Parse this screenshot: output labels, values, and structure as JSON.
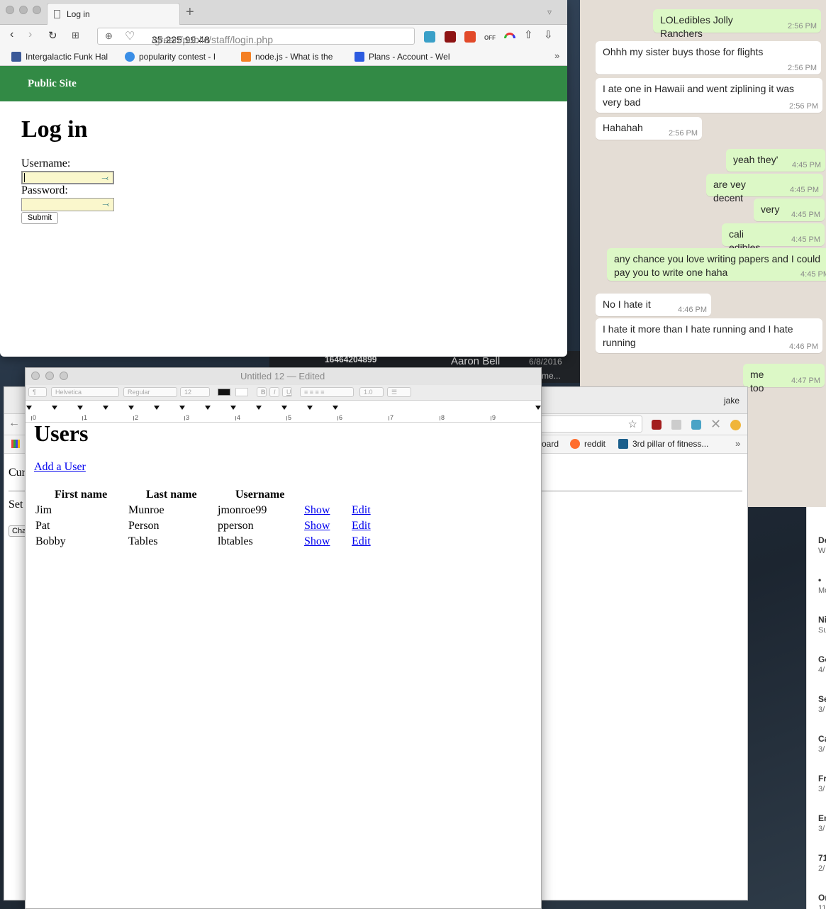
{
  "browser": {
    "tab_title": "Log in",
    "url_host": "35.225.99.48",
    "url_path": "/green/public/staff/login.php",
    "bookmarks": [
      {
        "label": "Intergalactic Funk Hal",
        "color": "#3b5998"
      },
      {
        "label": "popularity contest - I",
        "color": "#3a8ee6"
      },
      {
        "label": "node.js - What is the",
        "color": "#f48024"
      },
      {
        "label": "Plans - Account - Wel",
        "color": "#2c5be0"
      }
    ]
  },
  "login_page": {
    "header_link": "Public Site",
    "heading": "Log in",
    "username_label": "Username:",
    "password_label": "Password:",
    "submit_label": "Submit",
    "header_color": "#328a45"
  },
  "textedit": {
    "title": "Untitled 12 — Edited",
    "font": "Helvetica",
    "style": "Regular",
    "size": "12",
    "spacing": "1.0",
    "ruler_numbers": [
      "0",
      "1",
      "2",
      "3",
      "4",
      "5",
      "6",
      "7",
      "8",
      "9"
    ]
  },
  "users_page": {
    "heading": "Users",
    "add_link": "Add a User",
    "columns": [
      "First name",
      "Last name",
      "Username"
    ],
    "rows": [
      {
        "first": "Jim",
        "last": "Munroe",
        "username": "jmonroe99",
        "show": "Show",
        "edit": "Edit"
      },
      {
        "first": "Pat",
        "last": "Person",
        "username": "pperson",
        "show": "Show",
        "edit": "Edit"
      },
      {
        "first": "Bobby",
        "last": "Tables",
        "username": "lbtables",
        "show": "Show",
        "edit": "Edit"
      }
    ]
  },
  "background_chrome": {
    "user": "jake",
    "bookmarks": [
      "oard",
      "reddit",
      "3rd pillar of fitness..."
    ],
    "partial_text": [
      "Cur",
      "Set",
      "Cha"
    ]
  },
  "contact_strip": {
    "phone": "16464204899",
    "name": "Aaron Bell",
    "date": "6/8/2016",
    "snippet": "me..."
  },
  "chat": [
    {
      "dir": "out",
      "text": "LOLedibles Jolly Ranchers",
      "time": "2:56 PM"
    },
    {
      "dir": "in",
      "text": "Ohhh my sister buys those for flights",
      "time": "2:56 PM"
    },
    {
      "dir": "in",
      "text": "I ate one in Hawaii and went ziplining it was very bad",
      "time": "2:56 PM"
    },
    {
      "dir": "in",
      "text": "Hahahah",
      "time": "2:56 PM"
    },
    {
      "dir": "out",
      "text": "yeah they'",
      "time": "4:45 PM"
    },
    {
      "dir": "out",
      "text": "are vey decent",
      "time": "4:45 PM"
    },
    {
      "dir": "out",
      "text": "very",
      "time": "4:45 PM"
    },
    {
      "dir": "out",
      "text": "cali edibles",
      "time": "4:45 PM"
    },
    {
      "dir": "out",
      "text": "any chance you love writing papers and I could pay you to write one haha",
      "time": "4:45 PM"
    },
    {
      "dir": "in",
      "text": "No I hate it",
      "time": "4:46 PM"
    },
    {
      "dir": "in",
      "text": "I hate it more than I hate running and I hate running",
      "time": "4:46 PM"
    },
    {
      "dir": "out",
      "text": "me too",
      "time": "4:47 PM"
    }
  ],
  "sidebar_fragments": [
    {
      "t": "De",
      "s": "W"
    },
    {
      "t": "•",
      "s": "Mo"
    },
    {
      "t": "Ni",
      "s": "Su"
    },
    {
      "t": "Go",
      "s": "4/"
    },
    {
      "t": "Se",
      "s": "3/"
    },
    {
      "t": "Ca",
      "s": "3/"
    },
    {
      "t": "Fr",
      "s": "3/"
    },
    {
      "t": "En",
      "s": "3/"
    },
    {
      "t": "71",
      "s": "2/"
    },
    {
      "t": "Or",
      "s": "11"
    }
  ]
}
